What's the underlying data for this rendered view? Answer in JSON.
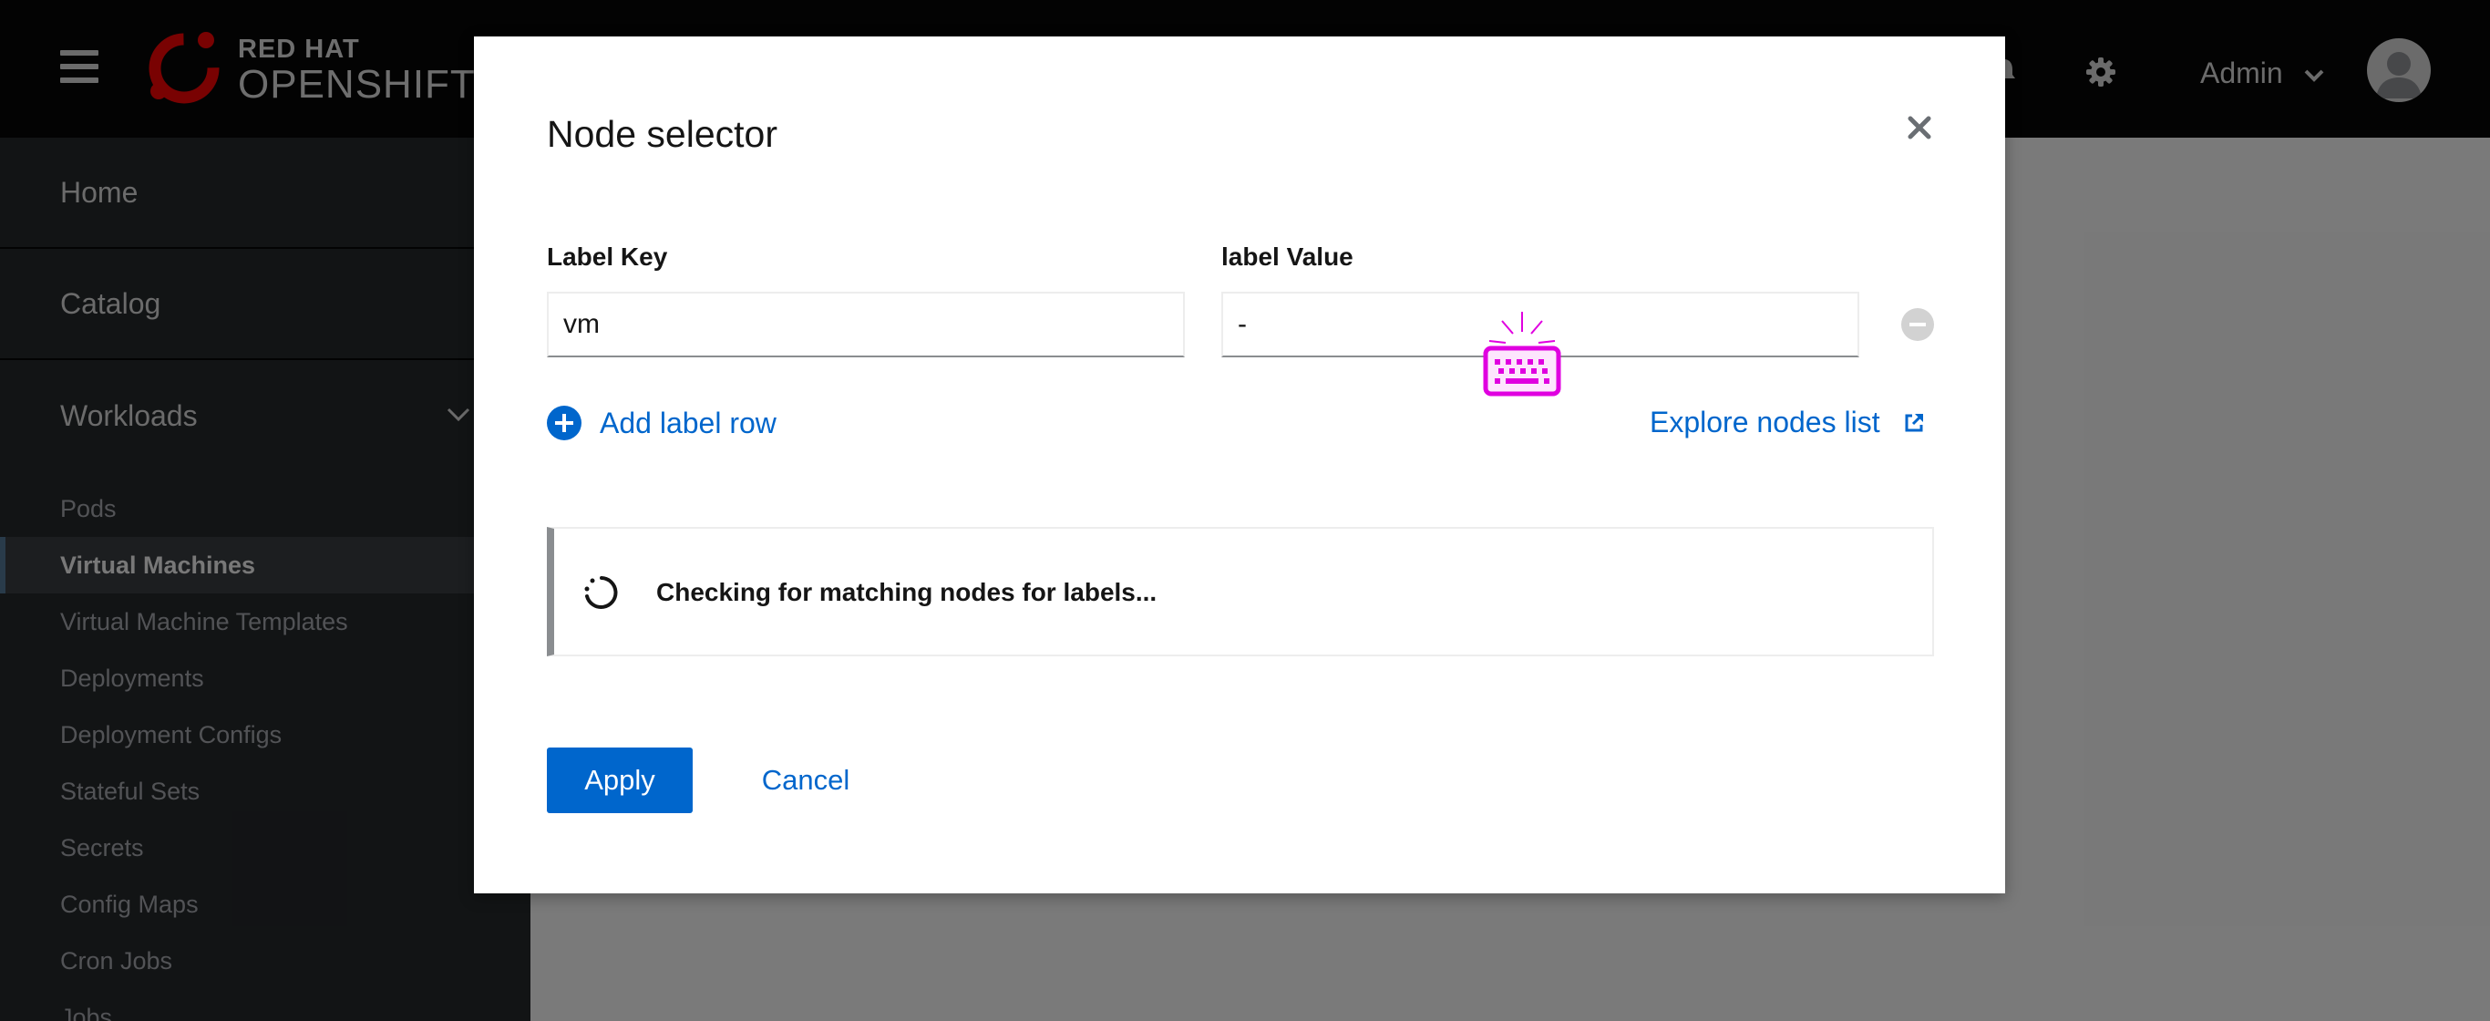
{
  "masthead": {
    "brand_top": "RED HAT",
    "brand_bottom": "OPENSHIFT",
    "user_label": "Admin",
    "icons": [
      "hamburger-icon",
      "redhat-logo",
      "bell-icon",
      "gear-icon",
      "chevron-down-icon",
      "avatar"
    ]
  },
  "sidebar": {
    "home": "Home",
    "catalog": "Catalog",
    "workloads": "Workloads",
    "items": [
      {
        "label": "Pods"
      },
      {
        "label": "Virtual Machines",
        "active": true
      },
      {
        "label": "Virtual Machine Templates"
      },
      {
        "label": "Deployments"
      },
      {
        "label": "Deployment Configs"
      },
      {
        "label": "Stateful Sets"
      },
      {
        "label": "Secrets"
      },
      {
        "label": "Config Maps"
      },
      {
        "label": "Cron Jobs"
      },
      {
        "label": "Jobs"
      }
    ]
  },
  "modal": {
    "title": "Node selector",
    "label_key_header": "Label Key",
    "label_value_header": "label Value",
    "key_value": "vm",
    "value_value": "-",
    "add_row": "Add label row",
    "explore": "Explore nodes list",
    "alert_text": "Checking for matching nodes for labels...",
    "apply": "Apply",
    "cancel": "Cancel"
  },
  "colors": {
    "masthead": "#030303",
    "sidebar": "#212427",
    "link": "#0066cc",
    "primary": "#0066cc",
    "redhat_red": "#ee0000",
    "keyboard_indicator": "#e000e0"
  }
}
